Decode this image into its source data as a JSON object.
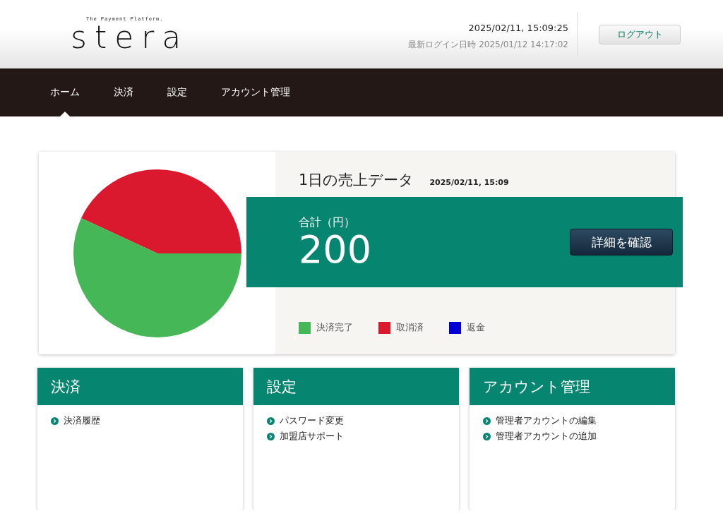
{
  "header": {
    "logo_tagline": "The Payment Platform.",
    "logo": "stera",
    "datetime": "2025/02/11, 15:09:25",
    "last_login": "最新ログイン日時 2025/01/12 14:17:02",
    "logout_button": "ログアウト"
  },
  "nav": [
    {
      "label": "ホーム",
      "selected": true
    },
    {
      "label": "決済",
      "selected": false
    },
    {
      "label": "設定",
      "selected": false
    },
    {
      "label": "アカウント管理",
      "selected": false
    }
  ],
  "sales": {
    "title": "1日の売上データ",
    "timestamp": "2025/02/11, 15:09",
    "total_label": "合計（円）",
    "total": "200",
    "detail_button": "詳細を確認",
    "legend": [
      {
        "label": "決済完了",
        "color": "#45b757"
      },
      {
        "label": "取消済",
        "color": "#da192f"
      },
      {
        "label": "返金",
        "color": "#0000d5"
      }
    ]
  },
  "panels": [
    {
      "title": "決済",
      "links": [
        "決済履歴"
      ]
    },
    {
      "title": "設定",
      "links": [
        "パスワード変更",
        "加盟店サポート"
      ]
    },
    {
      "title": "アカウント管理",
      "links": [
        "管理者アカウントの編集",
        "管理者アカウントの追加"
      ]
    }
  ]
}
